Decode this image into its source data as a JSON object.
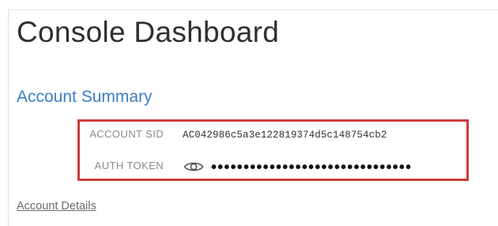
{
  "page": {
    "title": "Console Dashboard"
  },
  "account_summary": {
    "heading": "Account Summary",
    "account_sid": {
      "label": "ACCOUNT SID",
      "value": "AC042986c5a3e122819374d5c148754cb2"
    },
    "auth_token": {
      "label": "AUTH TOKEN",
      "masked_value": "•••••••••••••••••••••••••••••••",
      "icon": "eye-icon"
    }
  },
  "links": {
    "account_details": "Account Details"
  },
  "colors": {
    "heading_blue": "#3b7dc4",
    "highlight_red": "#cd3b3b",
    "title_text": "#2f2f2f",
    "label_gray": "#8a8a8a"
  }
}
